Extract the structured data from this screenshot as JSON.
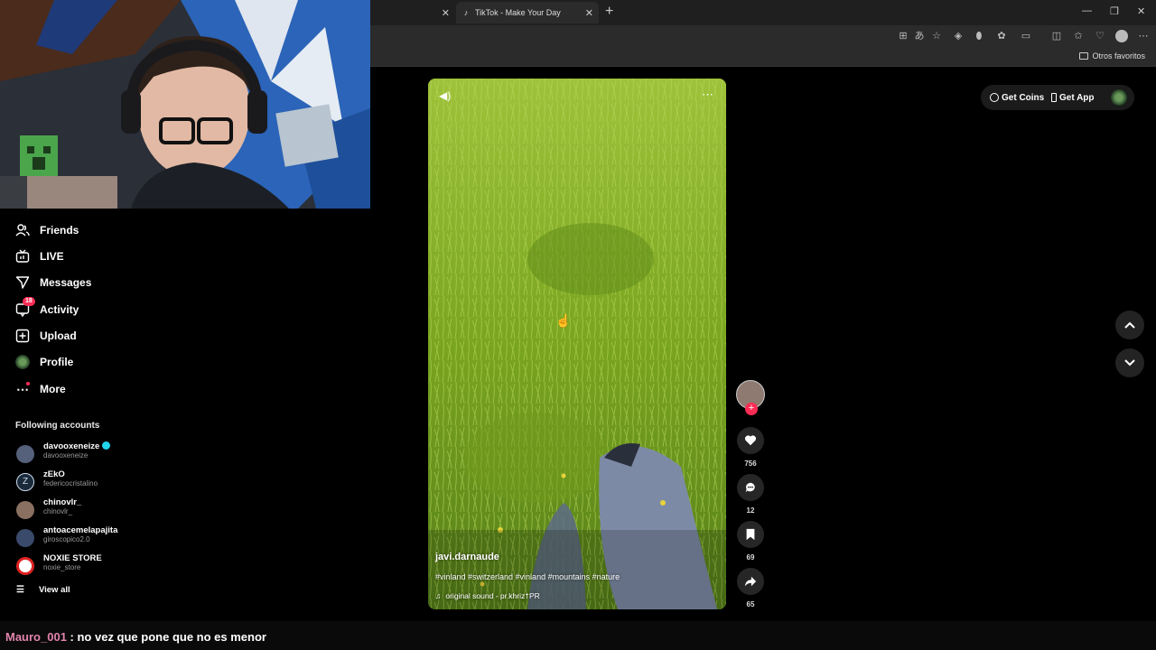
{
  "browser": {
    "tab_active_title": "TikTok - Make Your Day",
    "favorites_folder": "Otros favoritos"
  },
  "sidebar": {
    "items": [
      {
        "label": "Friends",
        "icon": "friends-icon"
      },
      {
        "label": "LIVE",
        "icon": "live-icon"
      },
      {
        "label": "Messages",
        "icon": "messages-icon"
      },
      {
        "label": "Activity",
        "icon": "activity-icon",
        "badge": "18"
      },
      {
        "label": "Upload",
        "icon": "upload-icon"
      },
      {
        "label": "Profile",
        "icon": "profile-avatar"
      },
      {
        "label": "More",
        "icon": "more-icon"
      }
    ],
    "following_title": "Following accounts",
    "accounts": [
      {
        "name": "davooxeneize",
        "handle": "davooxeneize",
        "verified": true
      },
      {
        "name": "zEkO",
        "handle": "federicocristalino"
      },
      {
        "name": "chinovlr_",
        "handle": "chinovlr_"
      },
      {
        "name": "antoacemelapajita",
        "handle": "giroscopico2.0"
      },
      {
        "name": "NOXIE STORE",
        "handle": "noxie_store"
      }
    ],
    "view_all": "View all"
  },
  "header": {
    "get_coins": "Get Coins",
    "get_app": "Get App"
  },
  "video": {
    "author": "javi.darnaude",
    "caption": "#vinland #switzerland #vinland #mountains #nature",
    "sound": "original sound - pr.khriz†PR",
    "likes": "756",
    "comments": "12",
    "saves": "69",
    "shares": "65"
  },
  "chat": {
    "user": "Mauro_001",
    "message": ": no vez que pone que no es menor"
  },
  "colors": {
    "accent": "#fe2c55",
    "verified": "#20d5ec",
    "chat_user": "#e084ad"
  }
}
